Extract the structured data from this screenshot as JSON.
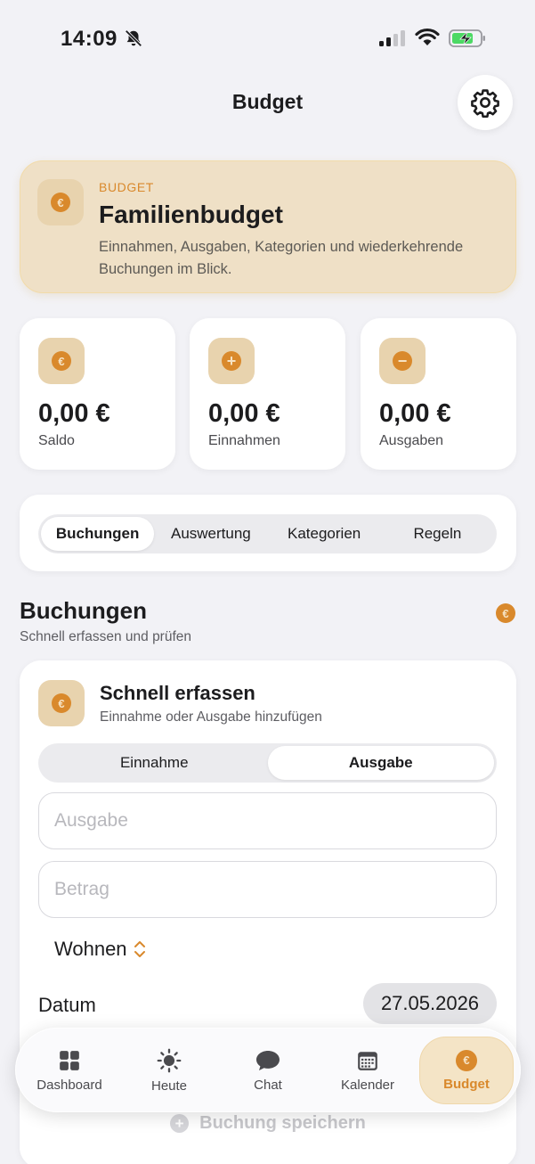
{
  "status_bar": {
    "time": "14:09"
  },
  "header": {
    "title": "Budget"
  },
  "hero": {
    "eyebrow": "BUDGET",
    "title": "Familienbudget",
    "subtitle": "Einnahmen, Ausgaben, Kategorien und wiederkehrende Buchungen im Blick."
  },
  "stats": [
    {
      "value": "0,00 €",
      "label": "Saldo",
      "icon": "euro-coin-icon"
    },
    {
      "value": "0,00 €",
      "label": "Einnahmen",
      "icon": "plus-coin-icon"
    },
    {
      "value": "0,00 €",
      "label": "Ausgaben",
      "icon": "minus-coin-icon"
    }
  ],
  "tabs": [
    {
      "label": "Buchungen",
      "active": true
    },
    {
      "label": "Auswertung",
      "active": false
    },
    {
      "label": "Kategorien",
      "active": false
    },
    {
      "label": "Regeln",
      "active": false
    }
  ],
  "section": {
    "title": "Buchungen",
    "subtitle": "Schnell erfassen und prüfen"
  },
  "quick_entry": {
    "title": "Schnell erfassen",
    "subtitle": "Einnahme oder Ausgabe hinzufügen",
    "type_options": [
      {
        "label": "Einnahme",
        "active": false
      },
      {
        "label": "Ausgabe",
        "active": true
      }
    ],
    "description_placeholder": "Ausgabe",
    "amount_placeholder": "Betrag",
    "category": "Wohnen",
    "date_label": "Datum",
    "date_value": "27.05.2026",
    "save_label": "Buchung speichern"
  },
  "bottom_nav": [
    {
      "label": "Dashboard",
      "icon": "grid-icon",
      "active": false
    },
    {
      "label": "Heute",
      "icon": "sun-icon",
      "active": false
    },
    {
      "label": "Chat",
      "icon": "chat-bubble-icon",
      "active": false
    },
    {
      "label": "Kalender",
      "icon": "calendar-icon",
      "active": false
    },
    {
      "label": "Budget",
      "icon": "euro-coin-icon",
      "active": true
    }
  ],
  "colors": {
    "accent": "#d9892c",
    "hero_bg": "#efe0c6",
    "icon_tile_bg": "#e8d3ae",
    "page_bg": "#f2f2f6"
  }
}
